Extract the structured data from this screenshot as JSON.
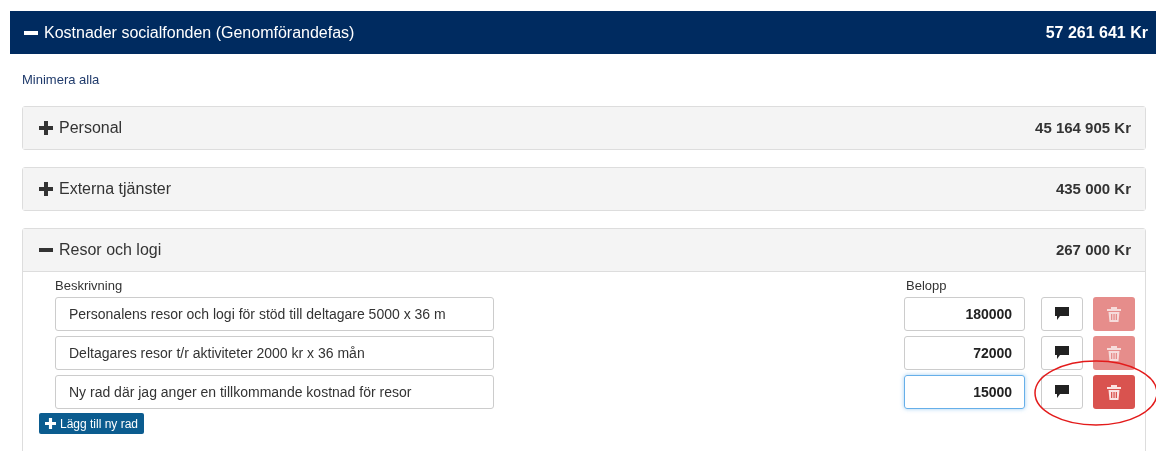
{
  "header": {
    "title": "Kostnader socialfonden (Genomförandefas)",
    "total": "57 261 641 Kr",
    "expanded": true
  },
  "collapse_all_link": "Minimera alla",
  "panels": [
    {
      "title": "Personal",
      "total": "45 164 905 Kr",
      "expanded": false
    },
    {
      "title": "Externa tjänster",
      "total": "435 000 Kr",
      "expanded": false
    },
    {
      "title": "Resor och logi",
      "total": "267 000 Kr",
      "expanded": true,
      "description_label": "Beskrivning",
      "amount_label": "Belopp",
      "rows": [
        {
          "description": "Personalens resor och logi för stöd till deltagare 5000 x 36 m",
          "amount": "180000",
          "focused": false,
          "delete_disabled": true,
          "highlighted": false
        },
        {
          "description": "Deltagares resor t/r aktiviteter 2000 kr x 36 mån",
          "amount": "72000",
          "focused": false,
          "delete_disabled": true,
          "highlighted": false
        },
        {
          "description": "Ny rad där jag anger en tillkommande kostnad för resor",
          "amount": "15000",
          "focused": true,
          "delete_disabled": false,
          "highlighted": true
        }
      ],
      "add_button": "Lägg till ny rad"
    }
  ]
}
